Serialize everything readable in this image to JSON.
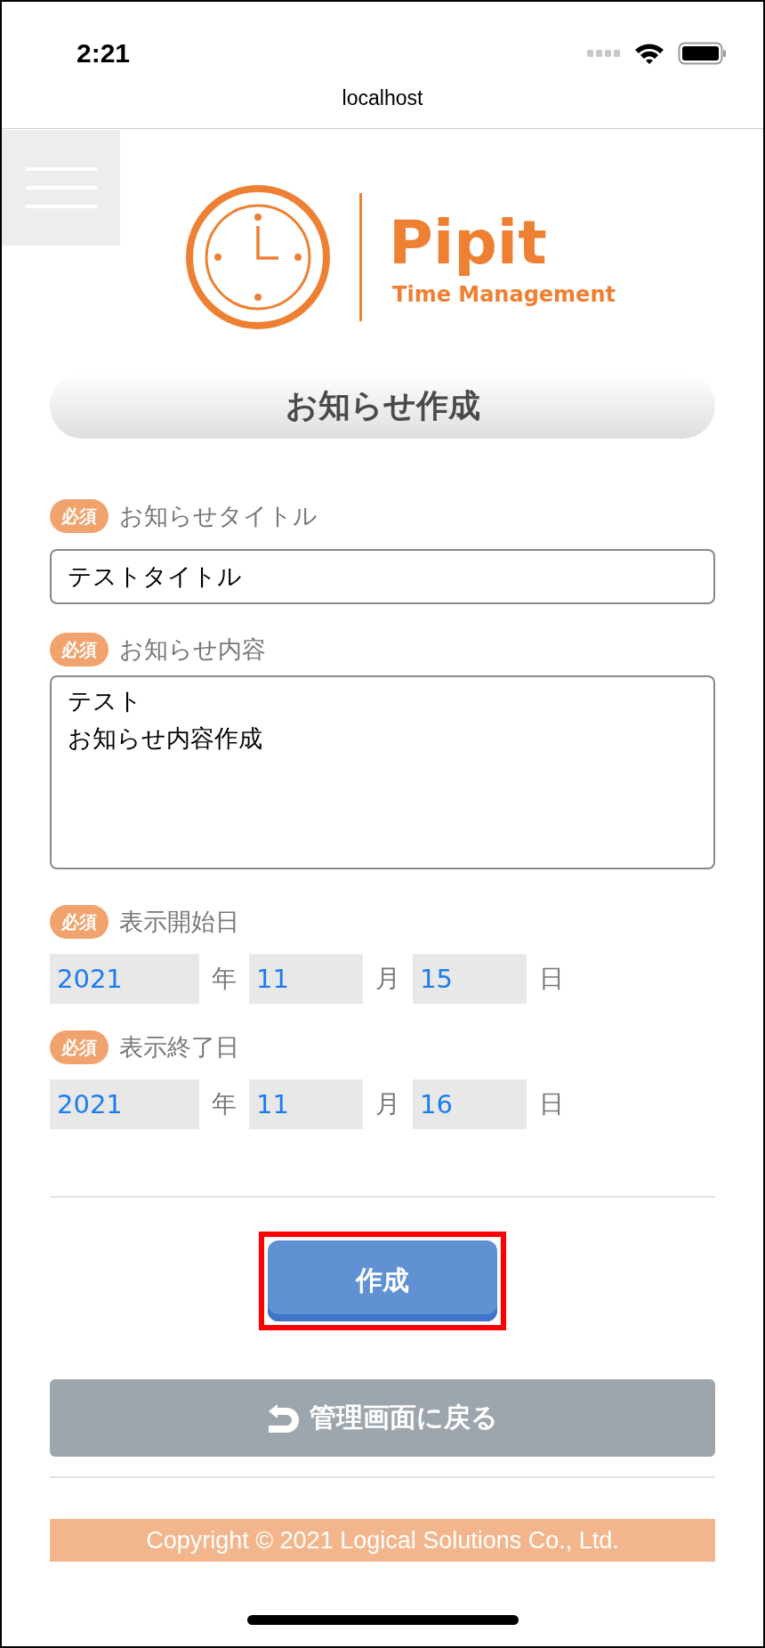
{
  "status_bar": {
    "time": "2:21"
  },
  "browser": {
    "url": "localhost"
  },
  "logo": {
    "name": "Pipit",
    "tagline": "Time Management"
  },
  "heading": "お知らせ作成",
  "fields": [
    {
      "kind": "text",
      "badge": "必須",
      "label": "お知らせタイトル",
      "value": "テストタイトル"
    },
    {
      "kind": "textarea",
      "badge": "必須",
      "label": "お知らせ内容",
      "lines": [
        "テスト",
        "お知らせ内容作成"
      ]
    },
    {
      "kind": "date",
      "badge": "必須",
      "label": "表示開始日",
      "parts": [
        {
          "value": "2021",
          "unit": "年"
        },
        {
          "value": "11",
          "unit": "月"
        },
        {
          "value": "15",
          "unit": "日"
        }
      ]
    },
    {
      "kind": "date",
      "badge": "必須",
      "label": "表示終了日",
      "parts": [
        {
          "value": "2021",
          "unit": "年"
        },
        {
          "value": "11",
          "unit": "月"
        },
        {
          "value": "16",
          "unit": "日"
        }
      ]
    }
  ],
  "create_button": {
    "label": "作成",
    "highlighted": true
  },
  "back_button": {
    "label": "管理画面に戻る"
  },
  "footer": "Copyright © 2021 Logical Solutions Co., Ltd."
}
